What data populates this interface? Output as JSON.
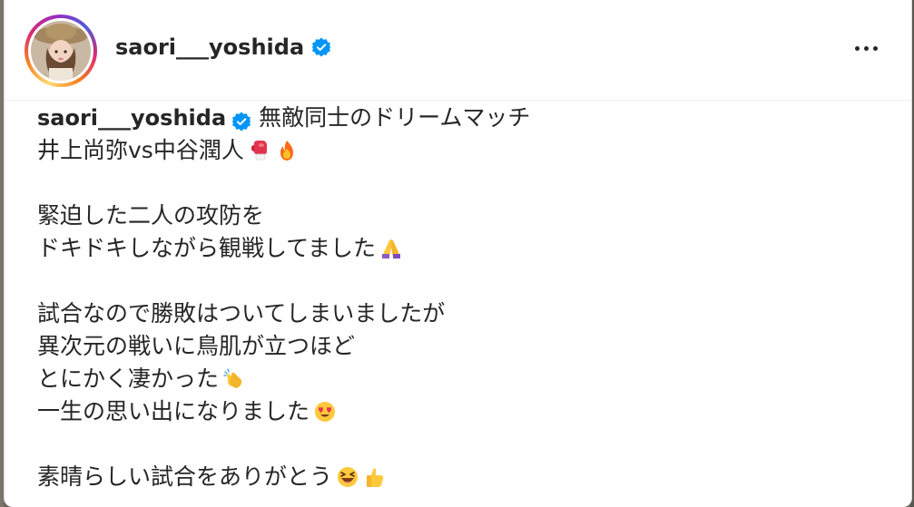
{
  "post": {
    "username": "saori___yoshida",
    "caption_lines": [
      "無敵同士のドリームマッチ",
      "井上尚弥vs中谷潤人",
      "",
      "緊迫した二人の攻防を",
      "ドキドキしながら観戦してました",
      "",
      "試合なので勝敗はついてしまいましたが",
      "異次元の戦いに鳥肌が立つほど",
      "とにかく凄かった",
      "一生の思い出になりました",
      "",
      "素晴らしい試合をありがとう"
    ],
    "emojis": {
      "line2": [
        "boxing-glove",
        "fire"
      ],
      "line5": [
        "folded-hands"
      ],
      "line9": [
        "clapping-hands"
      ],
      "line10": [
        "heart-eyes"
      ],
      "line12": [
        "grinning-squinting",
        "thumbs-up"
      ]
    }
  },
  "icons": {
    "verified": "verified-badge-icon",
    "more": "more-options-icon"
  },
  "colors": {
    "verified_blue": "#0095f6",
    "text": "#262626",
    "ring_start": "#feda75",
    "ring_end": "#962fbf"
  }
}
